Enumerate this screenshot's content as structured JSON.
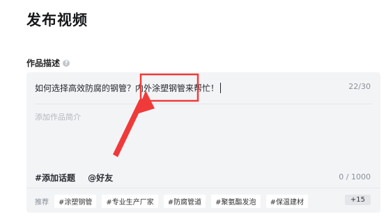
{
  "page": {
    "title": "发布视频"
  },
  "description_section": {
    "label": "作品描述",
    "help_icon": "?"
  },
  "editor": {
    "title_value": "如何选择高效防腐的钢管？内外涂塑钢管来帮忙！",
    "title_count": "22/30",
    "description_placeholder": "添加作品简介",
    "topic_button": "#添加话题",
    "mention_button": "@好友",
    "description_count": "0 / 1000"
  },
  "suggestions": {
    "label": "推荐",
    "tags": [
      "#涂塑钢管",
      "#专业生产厂家",
      "#防腐管道",
      "#聚氨酯发泡",
      "#保温建材"
    ],
    "more": "+15"
  },
  "annotation": {
    "color": "#f03a3a"
  }
}
